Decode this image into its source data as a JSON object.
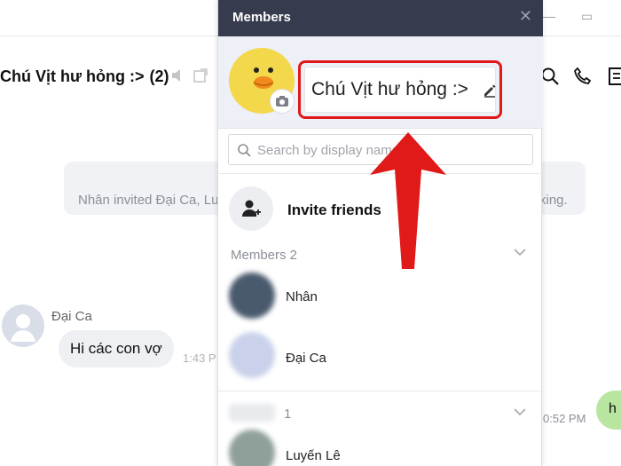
{
  "chat": {
    "title": "Chú Vịt hư hỏng :>",
    "member_count": "(2)",
    "system_message_left": "Nhân invited Đại Ca, Lu",
    "system_message_right": "king.",
    "sender": "Đại Ca",
    "message": "Hi các con vợ",
    "time_left": "1:43 P",
    "time_right": "0:52 PM",
    "bubble_right": "h"
  },
  "panel": {
    "title": "Members",
    "group_name": "Chú Vịt hư hỏng :>",
    "search_placeholder": "Search by display name",
    "invite_label": "Invite friends",
    "members_section": "Members 2",
    "members": [
      {
        "name": "Nhân",
        "color": "#4a5a6e"
      },
      {
        "name": "Đại Ca",
        "color": "#c9d2ea"
      }
    ],
    "invited_count": "1",
    "invited": [
      {
        "name": "Luyến Lê",
        "color": "#8fa09a"
      }
    ]
  },
  "colors": {
    "header_bg": "#363b4d",
    "highlight": "#e01919",
    "avatar_yellow": "#f4d84b"
  },
  "icons": [
    "close-icon",
    "camera-icon",
    "edit-icon",
    "search-icon",
    "add-user-icon",
    "chevron-down-icon",
    "phone-icon",
    "speaker-icon",
    "external-icon"
  ]
}
